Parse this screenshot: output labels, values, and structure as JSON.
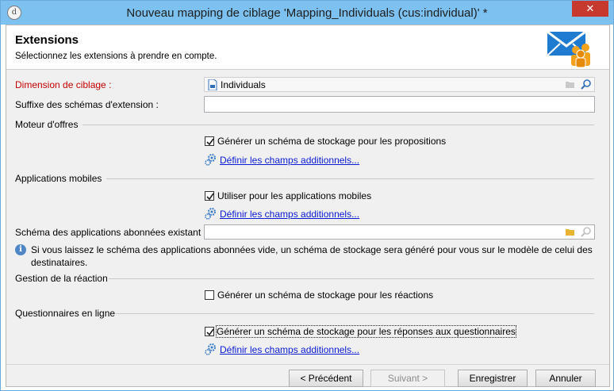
{
  "window": {
    "title": "Nouveau mapping de ciblage 'Mapping_Individuals (cus:individual)' *",
    "close_label": "✕"
  },
  "header": {
    "title": "Extensions",
    "subtitle": "Sélectionnez les extensions à prendre en compte."
  },
  "form": {
    "targeting_dimension_label": "Dimension de ciblage :",
    "targeting_dimension_value": "Individuals",
    "suffix_label": "Suffixe des schémas d'extension :",
    "suffix_value": ""
  },
  "offer_engine": {
    "section_label": "Moteur d'offres",
    "checkbox_label": "Générer un schéma de stockage pour les propositions",
    "checked": true,
    "link_label": "Définir les champs additionnels..."
  },
  "mobile_apps": {
    "section_label": "Applications mobiles",
    "checkbox_label": "Utiliser pour les applications mobiles",
    "checked": true,
    "link_label": "Définir les champs additionnels...",
    "subscribed_schema_label": "Schéma des applications abonnées existant :",
    "subscribed_schema_value": "",
    "info_text": "Si vous laissez le schéma des applications abonnées vide, un schéma de stockage sera généré pour vous sur le modèle de celui des destinataires."
  },
  "reaction": {
    "section_label": "Gestion de la réaction",
    "checkbox_label": "Générer un schéma de stockage pour les réactions",
    "checked": false
  },
  "surveys": {
    "section_label": "Questionnaires en ligne",
    "checkbox_label": "Générer un schéma de stockage pour les réponses aux questionnaires",
    "checked": true,
    "link_label": "Définir les champs additionnels..."
  },
  "footer": {
    "previous_label": "< Précédent",
    "next_label": "Suivant >",
    "save_label": "Enregistrer",
    "cancel_label": "Annuler"
  },
  "colors": {
    "titlebar": "#7cc1ef",
    "close": "#c7382e",
    "link": "#0a1bd5",
    "required_label": "#c40000"
  }
}
